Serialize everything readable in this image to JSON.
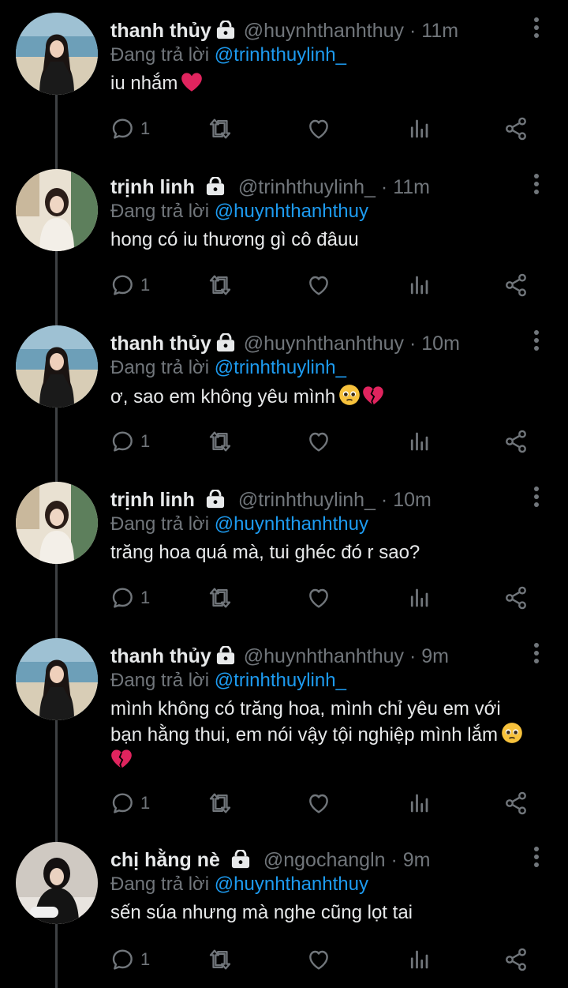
{
  "tweets": [
    {
      "name": "thanh thủy",
      "handle": "@huynhthanhthuy",
      "dot": "·",
      "time": "11m",
      "reply_prefix": "Đang trả lời ",
      "reply_to": "@trinhthuylinh_",
      "text": "iu nhắm",
      "reply_count": "1",
      "avatar": "beach-woman"
    },
    {
      "name": "trịnh linh",
      "handle": "@trinhthuylinh_",
      "dot": "·",
      "time": "11m",
      "reply_prefix": "Đang trả lời ",
      "reply_to": "@huynhthanhthuy",
      "text": "hong có iu thương gì cô đâuu",
      "reply_count": "1",
      "avatar": "white-dress-woman"
    },
    {
      "name": "thanh thủy",
      "handle": "@huynhthanhthuy",
      "dot": "·",
      "time": "10m",
      "reply_prefix": "Đang trả lời ",
      "reply_to": "@trinhthuylinh_",
      "text": "ơ, sao em không yêu mình",
      "reply_count": "1",
      "avatar": "beach-woman"
    },
    {
      "name": "trịnh linh",
      "handle": "@trinhthuylinh_",
      "dot": "·",
      "time": "10m",
      "reply_prefix": "Đang trả lời ",
      "reply_to": "@huynhthanhthuy",
      "text": "trăng hoa quá mà, tui ghéc đó r sao?",
      "reply_count": "1",
      "avatar": "white-dress-woman"
    },
    {
      "name": "thanh thủy",
      "handle": "@huynhthanhthuy",
      "dot": "·",
      "time": "9m",
      "reply_prefix": "Đang trả lời ",
      "reply_to": "@trinhthuylinh_",
      "text_line1": "mình không có trăng hoa, mình chỉ yêu em với",
      "text_line2": "bạn hằng thui, em nói vậy tội nghiệp mình lắm",
      "reply_count": "1",
      "avatar": "beach-woman"
    },
    {
      "name": "chị hằng nè",
      "handle": "@ngochangln",
      "dot": "·",
      "time": "9m",
      "reply_prefix": "Đang trả lời ",
      "reply_to": "@huynhthanhthuy",
      "text": "sến súa nhưng mà nghe cũng lọt tai",
      "reply_count": "1",
      "avatar": "dark-hair-woman"
    }
  ],
  "colors": {
    "background": "#000000",
    "text": "#e7e9ea",
    "muted": "#71767b",
    "mention": "#1d9bf0",
    "heart": "#e0245e"
  },
  "icons": [
    "lock-icon",
    "more-icon",
    "reply-icon",
    "retweet-icon",
    "like-icon",
    "views-icon",
    "share-icon",
    "red-heart-emoji",
    "pleading-face-emoji",
    "broken-heart-emoji"
  ]
}
